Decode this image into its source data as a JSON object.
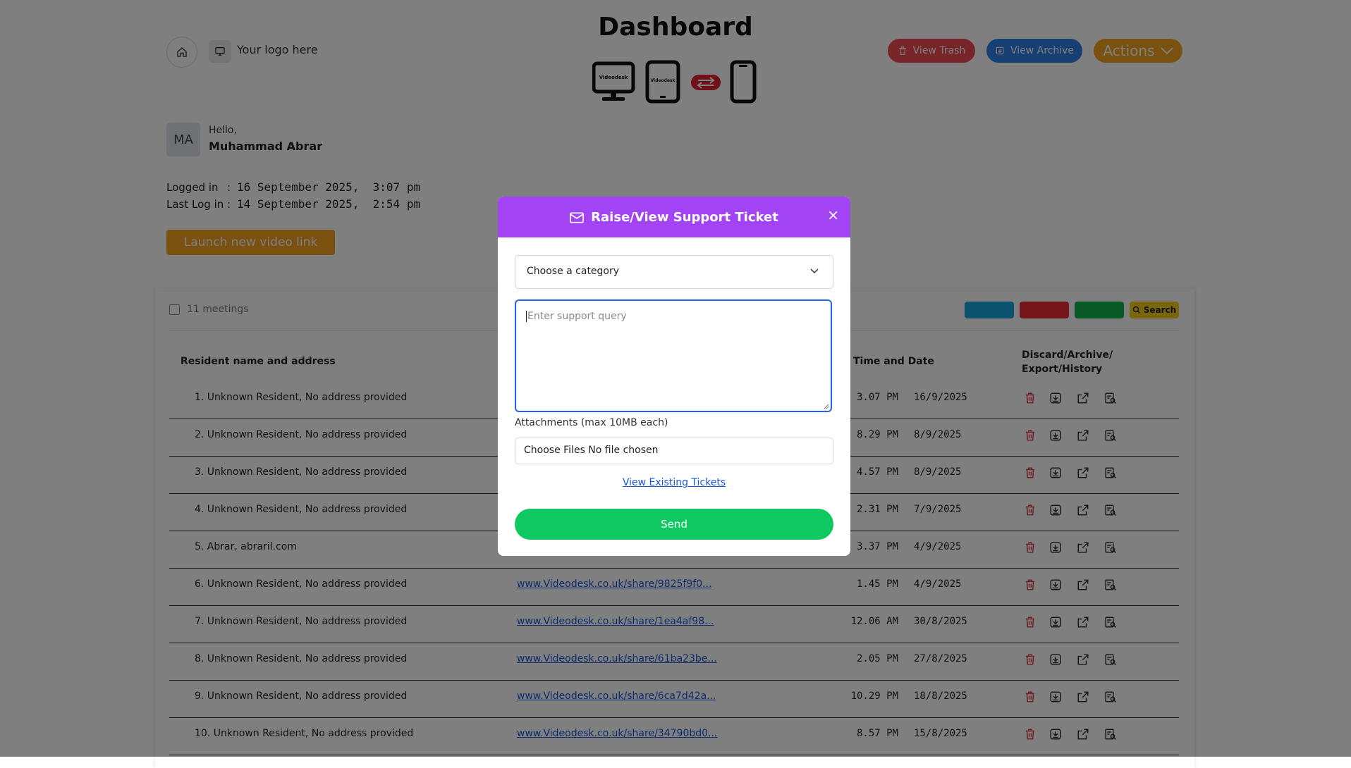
{
  "header": {
    "title": "Dashboard",
    "logo_text": "Your logo here",
    "device_label": "Videodesk",
    "view_trash": "View Trash",
    "view_archive": "View Archive",
    "actions": "Actions"
  },
  "user": {
    "initials": "MA",
    "greeting": "Hello,",
    "name": "Muhammad Abrar",
    "logged_in_label": "Logged in",
    "logged_in_value": "16 September 2025,  3:07 pm",
    "last_login_label": "Last Log in",
    "last_login_value": "14 September 2025,  2:54 pm",
    "colon": ":"
  },
  "launch_button": "Launch new video link",
  "table": {
    "meetings_count": "11 meetings",
    "search_label": "Search",
    "headers": {
      "resident": "Resident name and address",
      "time": "Time and Date",
      "actions_line1": "Discard/Archive/",
      "actions_line2": "Export/History"
    },
    "rows": [
      {
        "name": "1.  Unknown Resident, No address provided",
        "link": "",
        "time": "3.07 PM",
        "date": "16/9/2025"
      },
      {
        "name": "2.  Unknown Resident, No address provided",
        "link": "",
        "time": "8.29 PM",
        "date": "8/9/2025"
      },
      {
        "name": "3.  Unknown Resident, No address provided",
        "link": "",
        "time": "4.57 PM",
        "date": "8/9/2025"
      },
      {
        "name": "4.  Unknown Resident, No address provided",
        "link": "",
        "time": "2.31 PM",
        "date": "7/9/2025"
      },
      {
        "name": "5.  Abrar, abraril.com",
        "link": "",
        "time": "3.37 PM",
        "date": "4/9/2025"
      },
      {
        "name": "6.  Unknown Resident, No address provided",
        "link": "www.Videodesk.co.uk/share/9825f9f0...",
        "time": "1.45 PM",
        "date": "4/9/2025"
      },
      {
        "name": "7.  Unknown Resident, No address provided",
        "link": "www.Videodesk.co.uk/share/1ea4af98...",
        "time": "12.06 AM",
        "date": "30/8/2025"
      },
      {
        "name": "8.  Unknown Resident, No address provided",
        "link": "www.Videodesk.co.uk/share/61ba23be...",
        "time": "2.05 PM",
        "date": "27/8/2025"
      },
      {
        "name": "9.  Unknown Resident, No address provided",
        "link": "www.Videodesk.co.uk/share/6ca7d42a...",
        "time": "10.29 PM",
        "date": "18/8/2025"
      },
      {
        "name": "10.  Unknown Resident, No address provided",
        "link": "www.Videodesk.co.uk/share/34790bd0...",
        "time": "8.57 PM",
        "date": "15/8/2025"
      }
    ],
    "row_action_icons": [
      "trash-icon",
      "archive-icon",
      "export-icon",
      "history-icon"
    ]
  },
  "modal": {
    "title": "Raise/View Support Ticket",
    "close": "×",
    "category_placeholder": "Choose a category",
    "query_placeholder": "Enter support query",
    "attachments_label": "Attachments (max 10MB each)",
    "file_input_text": "Choose Files No file chosen",
    "view_existing": "View Existing Tickets",
    "send": "Send"
  },
  "colors": {
    "modal_header": "#a244f4",
    "send_button": "#0fc862",
    "trash_button": "#f04a55",
    "archive_button": "#2f7ee8",
    "actions_button": "#f4a21c",
    "launch_button": "#f5a21f",
    "focus_border": "#2563eb"
  }
}
